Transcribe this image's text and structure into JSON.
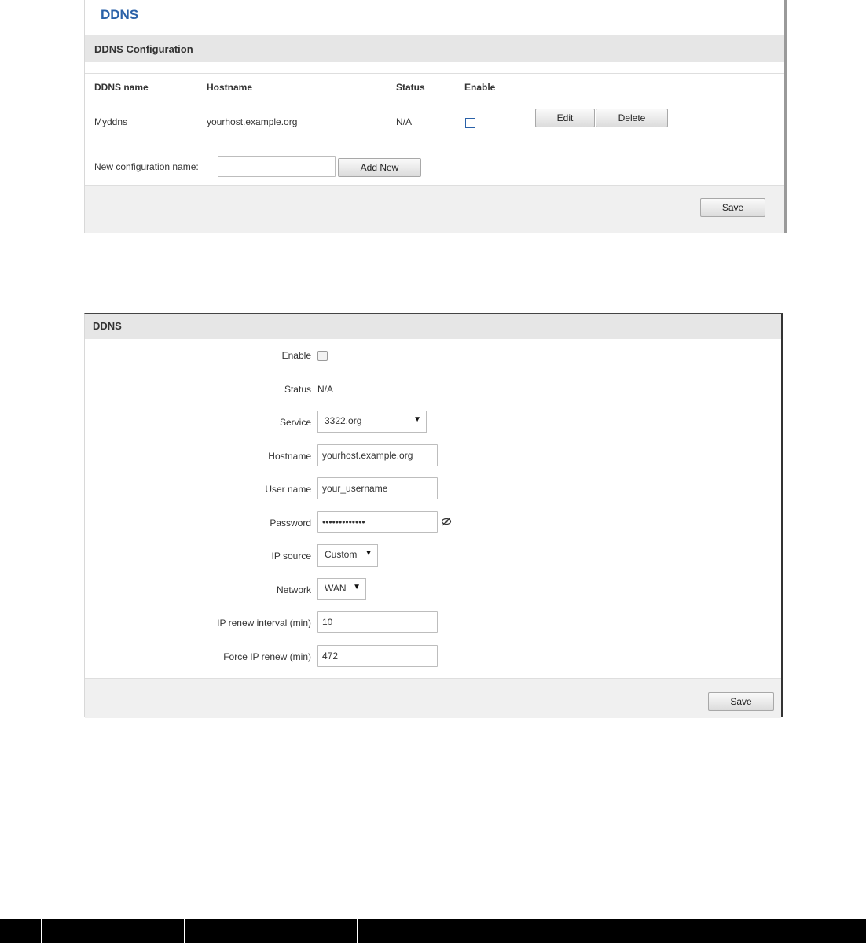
{
  "config_list": {
    "page_title": "DDNS",
    "section_title": "DDNS Configuration",
    "columns": [
      "DDNS name",
      "Hostname",
      "Status",
      "Enable"
    ],
    "rows": [
      {
        "name": "Myddns",
        "hostname": "yourhost.example.org",
        "status": "N/A",
        "enabled": false
      }
    ],
    "edit_label": "Edit",
    "delete_label": "Delete",
    "new_config_label": "New configuration name:",
    "new_config_value": "",
    "add_new_label": "Add New",
    "save_label": "Save"
  },
  "ddns_form": {
    "section_title": "DDNS",
    "enable_label": "Enable",
    "enable_checked": false,
    "status_label": "Status",
    "status_value": "N/A",
    "service_label": "Service",
    "service_value": "3322.org",
    "hostname_label": "Hostname",
    "hostname_value": "yourhost.example.org",
    "username_label": "User name",
    "username_value": "your_username",
    "password_label": "Password",
    "password_value": "•••••••••••••",
    "ip_source_label": "IP source",
    "ip_source_value": "Custom",
    "network_label": "Network",
    "network_value": "WAN",
    "renew_interval_label": "IP renew interval (min)",
    "renew_interval_value": "10",
    "force_renew_label": "Force IP renew (min)",
    "force_renew_value": "472",
    "save_label": "Save"
  },
  "colors": {
    "accent": "#2a61a8",
    "section_bg": "#e6e6e6",
    "footer_bg": "#f0f0f0"
  },
  "icons": {
    "password_toggle": "eye-slash-icon",
    "dropdown": "caret-down-icon"
  }
}
